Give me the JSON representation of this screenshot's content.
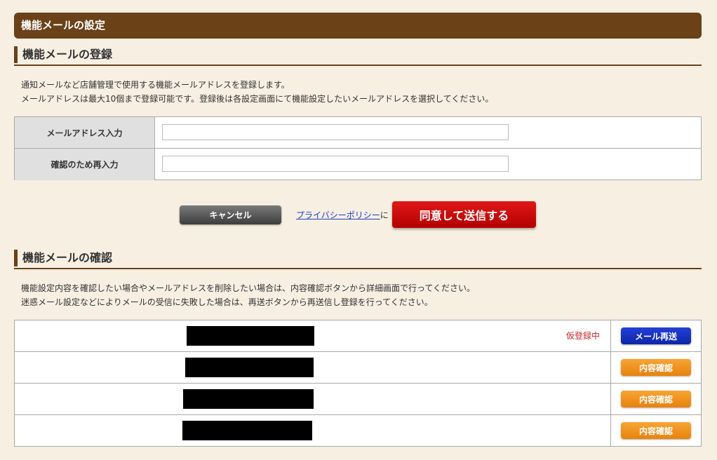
{
  "header": {
    "title": "機能メールの設定"
  },
  "register": {
    "title": "機能メールの登録",
    "desc": [
      "通知メールなど店舗管理で使用する機能メールアドレスを登録します。",
      "メールアドレスは最大10個まで登録可能です。登録後は各設定画面にて機能設定したいメールアドレスを選択してください。"
    ],
    "fields": [
      {
        "label": "メールアドレス入力",
        "value": "",
        "placeholder": ""
      },
      {
        "label": "確認のため再入力",
        "value": "",
        "placeholder": ""
      }
    ],
    "cancel_label": "キャンセル",
    "privacy_link": "プライバシーポリシー",
    "privacy_suffix": "に",
    "submit_label": "同意して送信する"
  },
  "confirm": {
    "title": "機能メールの確認",
    "desc": [
      "機能設定内容を確認したい場合やメールアドレスを削除したい場合は、内容確認ボタンから詳細画面で行ってください。",
      "迷惑メール設定などによりメールの受信に失敗した場合は、再送ボタンから再送信し登録を行ってください。"
    ],
    "rows": [
      {
        "email": "[redacted]",
        "status": "仮登録中",
        "action": "メール再送",
        "action_type": "resend"
      },
      {
        "email": "[redacted]",
        "status": "",
        "action": "内容確認",
        "action_type": "detail"
      },
      {
        "email": "[redacted]",
        "status": "",
        "action": "内容確認",
        "action_type": "detail"
      },
      {
        "email": "[redacted]",
        "status": "",
        "action": "内容確認",
        "action_type": "detail"
      }
    ]
  },
  "colors": {
    "header_bg": "#6b4118",
    "page_bg": "#f6efe2",
    "submit": "#cc0000",
    "resend": "#1a33c6",
    "detail": "#f0921f",
    "status_red": "#c3272b"
  }
}
